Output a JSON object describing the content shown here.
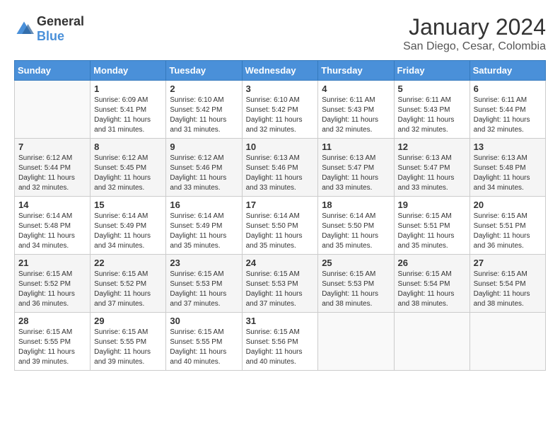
{
  "logo": {
    "general": "General",
    "blue": "Blue"
  },
  "title": "January 2024",
  "subtitle": "San Diego, Cesar, Colombia",
  "days_header": [
    "Sunday",
    "Monday",
    "Tuesday",
    "Wednesday",
    "Thursday",
    "Friday",
    "Saturday"
  ],
  "weeks": [
    [
      {
        "day": "",
        "sunrise": "",
        "sunset": "",
        "daylight": ""
      },
      {
        "day": "1",
        "sunrise": "Sunrise: 6:09 AM",
        "sunset": "Sunset: 5:41 PM",
        "daylight": "Daylight: 11 hours and 31 minutes."
      },
      {
        "day": "2",
        "sunrise": "Sunrise: 6:10 AM",
        "sunset": "Sunset: 5:42 PM",
        "daylight": "Daylight: 11 hours and 31 minutes."
      },
      {
        "day": "3",
        "sunrise": "Sunrise: 6:10 AM",
        "sunset": "Sunset: 5:42 PM",
        "daylight": "Daylight: 11 hours and 32 minutes."
      },
      {
        "day": "4",
        "sunrise": "Sunrise: 6:11 AM",
        "sunset": "Sunset: 5:43 PM",
        "daylight": "Daylight: 11 hours and 32 minutes."
      },
      {
        "day": "5",
        "sunrise": "Sunrise: 6:11 AM",
        "sunset": "Sunset: 5:43 PM",
        "daylight": "Daylight: 11 hours and 32 minutes."
      },
      {
        "day": "6",
        "sunrise": "Sunrise: 6:11 AM",
        "sunset": "Sunset: 5:44 PM",
        "daylight": "Daylight: 11 hours and 32 minutes."
      }
    ],
    [
      {
        "day": "7",
        "sunrise": "Sunrise: 6:12 AM",
        "sunset": "Sunset: 5:44 PM",
        "daylight": "Daylight: 11 hours and 32 minutes."
      },
      {
        "day": "8",
        "sunrise": "Sunrise: 6:12 AM",
        "sunset": "Sunset: 5:45 PM",
        "daylight": "Daylight: 11 hours and 32 minutes."
      },
      {
        "day": "9",
        "sunrise": "Sunrise: 6:12 AM",
        "sunset": "Sunset: 5:46 PM",
        "daylight": "Daylight: 11 hours and 33 minutes."
      },
      {
        "day": "10",
        "sunrise": "Sunrise: 6:13 AM",
        "sunset": "Sunset: 5:46 PM",
        "daylight": "Daylight: 11 hours and 33 minutes."
      },
      {
        "day": "11",
        "sunrise": "Sunrise: 6:13 AM",
        "sunset": "Sunset: 5:47 PM",
        "daylight": "Daylight: 11 hours and 33 minutes."
      },
      {
        "day": "12",
        "sunrise": "Sunrise: 6:13 AM",
        "sunset": "Sunset: 5:47 PM",
        "daylight": "Daylight: 11 hours and 33 minutes."
      },
      {
        "day": "13",
        "sunrise": "Sunrise: 6:13 AM",
        "sunset": "Sunset: 5:48 PM",
        "daylight": "Daylight: 11 hours and 34 minutes."
      }
    ],
    [
      {
        "day": "14",
        "sunrise": "Sunrise: 6:14 AM",
        "sunset": "Sunset: 5:48 PM",
        "daylight": "Daylight: 11 hours and 34 minutes."
      },
      {
        "day": "15",
        "sunrise": "Sunrise: 6:14 AM",
        "sunset": "Sunset: 5:49 PM",
        "daylight": "Daylight: 11 hours and 34 minutes."
      },
      {
        "day": "16",
        "sunrise": "Sunrise: 6:14 AM",
        "sunset": "Sunset: 5:49 PM",
        "daylight": "Daylight: 11 hours and 35 minutes."
      },
      {
        "day": "17",
        "sunrise": "Sunrise: 6:14 AM",
        "sunset": "Sunset: 5:50 PM",
        "daylight": "Daylight: 11 hours and 35 minutes."
      },
      {
        "day": "18",
        "sunrise": "Sunrise: 6:14 AM",
        "sunset": "Sunset: 5:50 PM",
        "daylight": "Daylight: 11 hours and 35 minutes."
      },
      {
        "day": "19",
        "sunrise": "Sunrise: 6:15 AM",
        "sunset": "Sunset: 5:51 PM",
        "daylight": "Daylight: 11 hours and 35 minutes."
      },
      {
        "day": "20",
        "sunrise": "Sunrise: 6:15 AM",
        "sunset": "Sunset: 5:51 PM",
        "daylight": "Daylight: 11 hours and 36 minutes."
      }
    ],
    [
      {
        "day": "21",
        "sunrise": "Sunrise: 6:15 AM",
        "sunset": "Sunset: 5:52 PM",
        "daylight": "Daylight: 11 hours and 36 minutes."
      },
      {
        "day": "22",
        "sunrise": "Sunrise: 6:15 AM",
        "sunset": "Sunset: 5:52 PM",
        "daylight": "Daylight: 11 hours and 37 minutes."
      },
      {
        "day": "23",
        "sunrise": "Sunrise: 6:15 AM",
        "sunset": "Sunset: 5:53 PM",
        "daylight": "Daylight: 11 hours and 37 minutes."
      },
      {
        "day": "24",
        "sunrise": "Sunrise: 6:15 AM",
        "sunset": "Sunset: 5:53 PM",
        "daylight": "Daylight: 11 hours and 37 minutes."
      },
      {
        "day": "25",
        "sunrise": "Sunrise: 6:15 AM",
        "sunset": "Sunset: 5:53 PM",
        "daylight": "Daylight: 11 hours and 38 minutes."
      },
      {
        "day": "26",
        "sunrise": "Sunrise: 6:15 AM",
        "sunset": "Sunset: 5:54 PM",
        "daylight": "Daylight: 11 hours and 38 minutes."
      },
      {
        "day": "27",
        "sunrise": "Sunrise: 6:15 AM",
        "sunset": "Sunset: 5:54 PM",
        "daylight": "Daylight: 11 hours and 38 minutes."
      }
    ],
    [
      {
        "day": "28",
        "sunrise": "Sunrise: 6:15 AM",
        "sunset": "Sunset: 5:55 PM",
        "daylight": "Daylight: 11 hours and 39 minutes."
      },
      {
        "day": "29",
        "sunrise": "Sunrise: 6:15 AM",
        "sunset": "Sunset: 5:55 PM",
        "daylight": "Daylight: 11 hours and 39 minutes."
      },
      {
        "day": "30",
        "sunrise": "Sunrise: 6:15 AM",
        "sunset": "Sunset: 5:55 PM",
        "daylight": "Daylight: 11 hours and 40 minutes."
      },
      {
        "day": "31",
        "sunrise": "Sunrise: 6:15 AM",
        "sunset": "Sunset: 5:56 PM",
        "daylight": "Daylight: 11 hours and 40 minutes."
      },
      {
        "day": "",
        "sunrise": "",
        "sunset": "",
        "daylight": ""
      },
      {
        "day": "",
        "sunrise": "",
        "sunset": "",
        "daylight": ""
      },
      {
        "day": "",
        "sunrise": "",
        "sunset": "",
        "daylight": ""
      }
    ]
  ]
}
